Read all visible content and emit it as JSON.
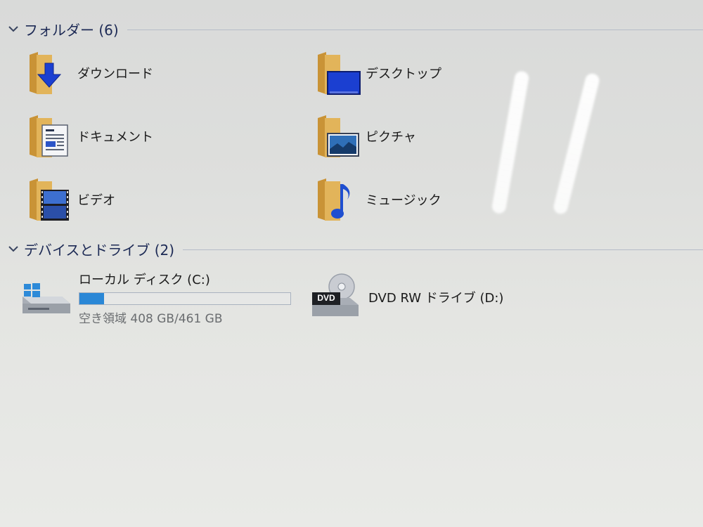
{
  "sections": {
    "folders": {
      "title": "フォルダー (6)"
    },
    "devices": {
      "title": "デバイスとドライブ (2)"
    }
  },
  "folders": [
    {
      "label": "ダウンロード",
      "icon": "download-folder-icon"
    },
    {
      "label": "デスクトップ",
      "icon": "desktop-folder-icon"
    },
    {
      "label": "ドキュメント",
      "icon": "documents-folder-icon"
    },
    {
      "label": "ピクチャ",
      "icon": "pictures-folder-icon"
    },
    {
      "label": "ビデオ",
      "icon": "videos-folder-icon"
    },
    {
      "label": "ミュージック",
      "icon": "music-folder-icon"
    }
  ],
  "drives": [
    {
      "name": "ローカル ディスク (C:)",
      "free_text": "空き領域 408 GB/461 GB",
      "used_fraction": 0.115,
      "icon": "windows-drive-icon"
    },
    {
      "name": "DVD RW ドライブ (D:)",
      "icon": "dvd-drive-icon",
      "badge": "DVD"
    }
  ],
  "colors": {
    "accent": "#2a87d6",
    "folder": "#d7a54b",
    "header_text": "#1d2a55"
  }
}
